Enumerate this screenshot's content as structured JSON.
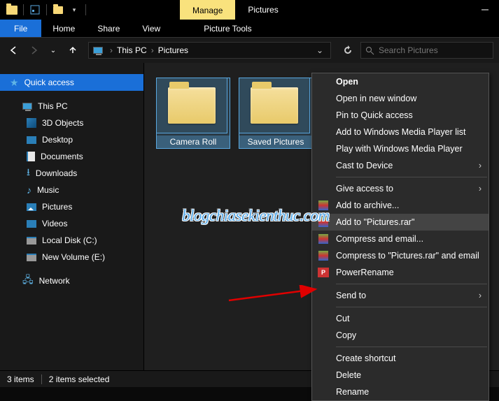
{
  "titlebar": {
    "manage_label": "Manage",
    "title": "Pictures"
  },
  "ribbon": {
    "file": "File",
    "home": "Home",
    "share": "Share",
    "view": "View",
    "tool": "Picture Tools"
  },
  "breadcrumb": {
    "seg1": "This PC",
    "seg2": "Pictures"
  },
  "search": {
    "placeholder": "Search Pictures"
  },
  "sidebar": {
    "quick_access": "Quick access",
    "this_pc": "This PC",
    "items": [
      "3D Objects",
      "Desktop",
      "Documents",
      "Downloads",
      "Music",
      "Pictures",
      "Videos",
      "Local Disk (C:)",
      "New Volume (E:)"
    ],
    "network": "Network"
  },
  "folders": [
    {
      "name": "Camera Roll"
    },
    {
      "name": "Saved Pictures"
    }
  ],
  "context_menu": {
    "open": "Open",
    "open_new": "Open in new window",
    "pin_quick": "Pin to Quick access",
    "wmp_list": "Add to Windows Media Player list",
    "wmp_play": "Play with Windows Media Player",
    "cast": "Cast to Device",
    "give_access": "Give access to",
    "add_archive": "Add to archive...",
    "add_rar": "Add to \"Pictures.rar\"",
    "compress_email": "Compress and email...",
    "compress_rar_email": "Compress to \"Pictures.rar\" and email",
    "powerrename": "PowerRename",
    "send_to": "Send to",
    "cut": "Cut",
    "copy": "Copy",
    "shortcut": "Create shortcut",
    "delete": "Delete",
    "rename": "Rename"
  },
  "status": {
    "count": "3 items",
    "selected": "2 items selected"
  },
  "watermark": "blogchiasekienthuc.com"
}
